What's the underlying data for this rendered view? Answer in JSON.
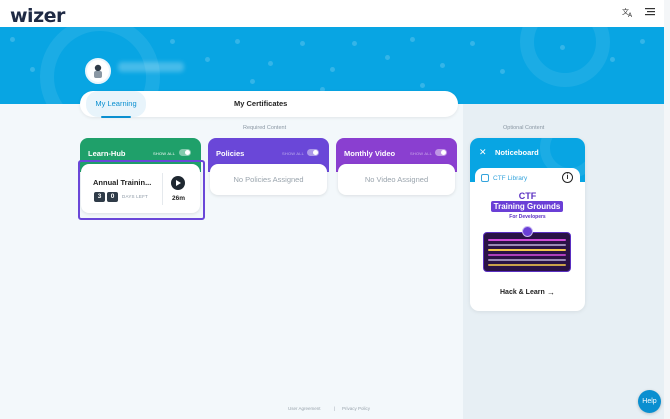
{
  "header": {
    "logo": "wizer",
    "translate_icon": "translate-icon",
    "menu_icon": "menu-icon"
  },
  "profile": {
    "avatar_icon": "user-avatar-icon"
  },
  "tabs": [
    {
      "label": "My Learning",
      "active": true
    },
    {
      "label": "My Certificates",
      "active": false
    }
  ],
  "sections": {
    "required": "Required Content",
    "optional": "Optional Content"
  },
  "cards": {
    "learn_hub": {
      "title": "Learn-Hub",
      "show_all": "SHOW ALL",
      "color": "#1fa06a",
      "course": {
        "title": "Annual Trainin...",
        "days": [
          "3",
          "0"
        ],
        "days_label": "DAYS LEFT",
        "duration": "26m"
      }
    },
    "policies": {
      "title": "Policies",
      "show_all": "SHOW ALL",
      "color": "#6a47d8",
      "empty": "No Policies Assigned"
    },
    "monthly_video": {
      "title": "Monthly Video",
      "show_all": "SHOW ALL",
      "color": "#8a3fd0",
      "empty": "No Video Assigned"
    }
  },
  "noticeboard": {
    "title": "Noticeboard",
    "tab_label": "CTF Library",
    "promo": {
      "heading": "CTF",
      "band": "Training Grounds",
      "subheading": "For Developers"
    },
    "link_label": "Hack & Learn"
  },
  "footer": {
    "user_agreement": "User Agreement",
    "separator": "|",
    "privacy_policy": "Privacy Policy"
  },
  "help_label": "Help"
}
